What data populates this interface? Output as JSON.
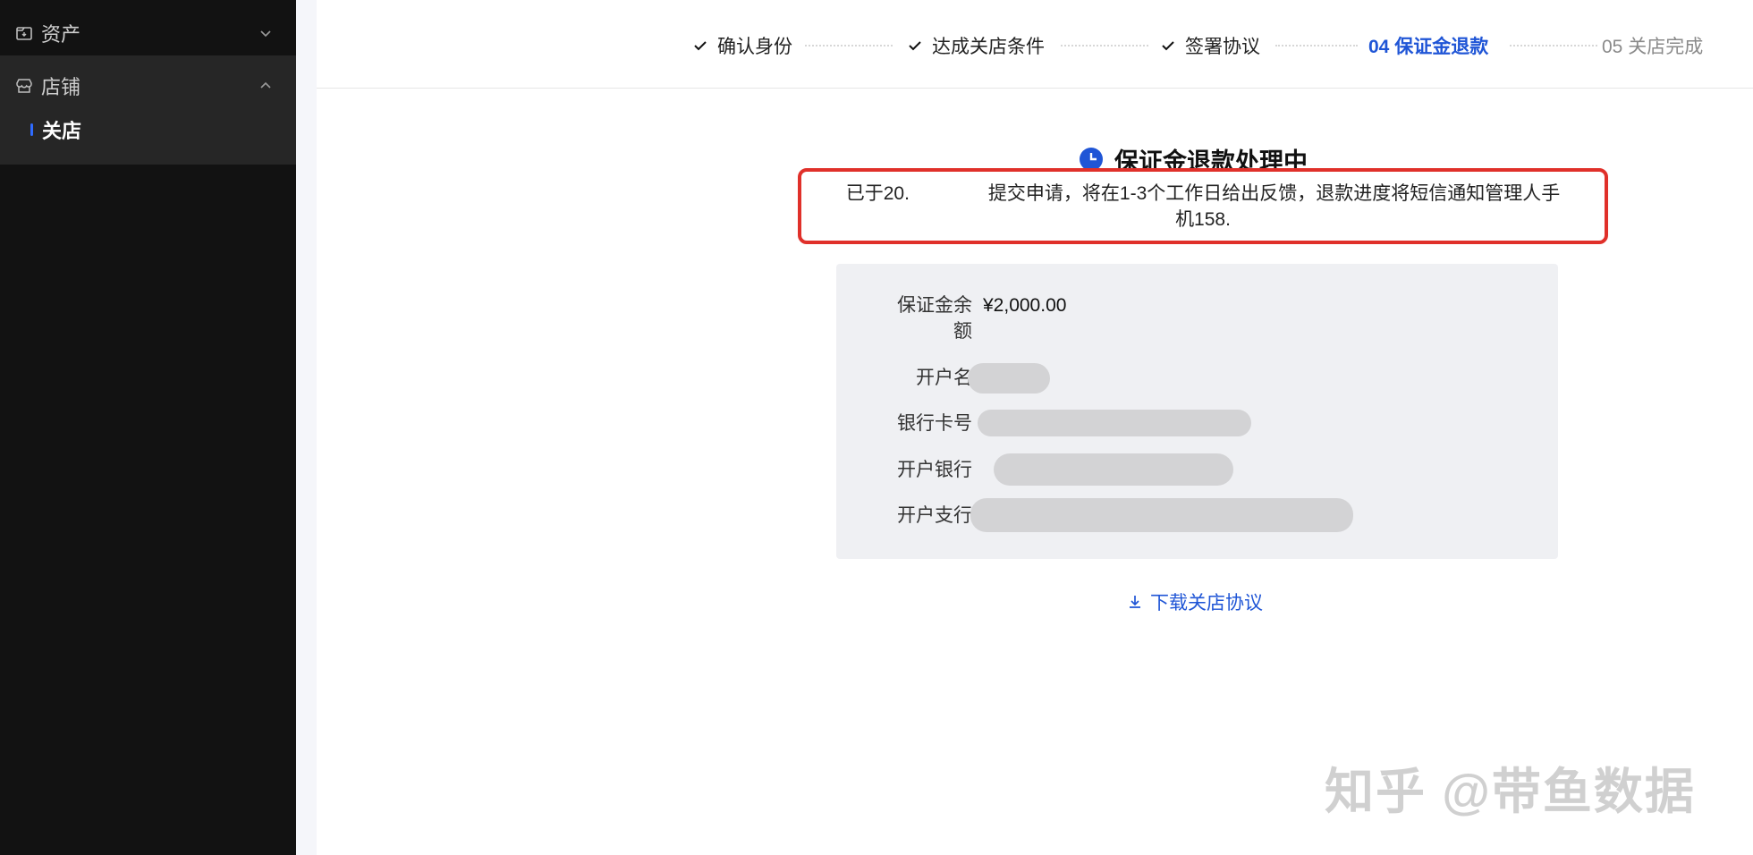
{
  "sidebar": {
    "groups": [
      {
        "label": "资产",
        "icon": "asset-box-icon",
        "expanded": false
      },
      {
        "label": "店铺",
        "icon": "shop-icon",
        "expanded": true
      }
    ],
    "active_item": "关店"
  },
  "steps": [
    {
      "label": "确认身份",
      "state": "done"
    },
    {
      "label": "达成关店条件",
      "state": "done"
    },
    {
      "label": "签署协议",
      "state": "done"
    },
    {
      "label": "04 保证金退款",
      "state": "active"
    },
    {
      "label": "05 关店完成",
      "state": "todo"
    }
  ],
  "status": {
    "title": "保证金退款处理中",
    "notice_line1_prefix": "已于20.",
    "notice_line1_suffix": "提交申请，将在1-3个工作日给出反馈，退款进度将短信通知管理人手",
    "notice_line2": "机158."
  },
  "info": {
    "balance_label_line1": "保证金余",
    "balance_label_line2": "额",
    "balance_value": "¥2,000.00",
    "account_name_label": "开户名",
    "card_number_label": "银行卡号",
    "bank_label": "开户银行",
    "branch_label": "开户支行"
  },
  "download_label": "下载关店协议",
  "watermark": "知乎 @带鱼数据",
  "colors": {
    "accent": "#1f55d6",
    "highlight_border": "#e0302a",
    "sidebar_bg": "#121212"
  }
}
